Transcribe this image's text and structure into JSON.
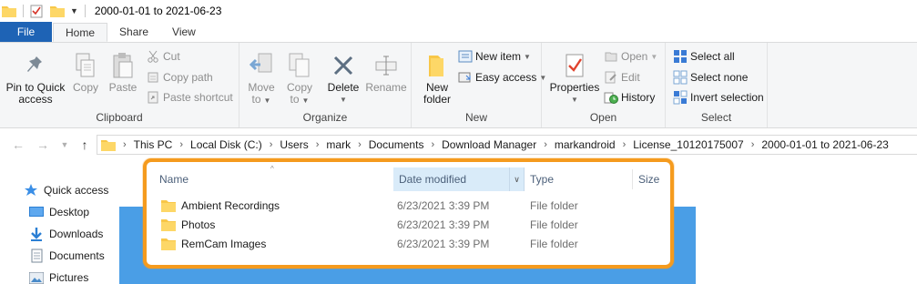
{
  "window": {
    "title": "2000-01-01 to 2021-06-23"
  },
  "tabs": [
    {
      "label": "File"
    },
    {
      "label": "Home"
    },
    {
      "label": "Share"
    },
    {
      "label": "View"
    }
  ],
  "ribbon": {
    "clipboard": {
      "label": "Clipboard",
      "pin_line1": "Pin to Quick",
      "pin_line2": "access",
      "copy": "Copy",
      "paste": "Paste",
      "cut": "Cut",
      "copy_path": "Copy path",
      "paste_shortcut": "Paste shortcut"
    },
    "organize": {
      "label": "Organize",
      "move_line1": "Move",
      "move_line2": "to",
      "copy_line1": "Copy",
      "copy_line2": "to",
      "delete": "Delete",
      "rename": "Rename"
    },
    "new": {
      "label": "New",
      "new_folder_line1": "New",
      "new_folder_line2": "folder",
      "new_item": "New item",
      "easy_access": "Easy access"
    },
    "open": {
      "label": "Open",
      "properties": "Properties",
      "open": "Open",
      "edit": "Edit",
      "history": "History"
    },
    "select": {
      "label": "Select",
      "select_all": "Select all",
      "select_none": "Select none",
      "invert_selection": "Invert selection"
    }
  },
  "breadcrumb": [
    "This PC",
    "Local Disk (C:)",
    "Users",
    "mark",
    "Documents",
    "Download Manager",
    "markandroid",
    "License_10120175007",
    "2000-01-01 to 2021-06-23"
  ],
  "nav_pane": [
    {
      "label": "Quick access",
      "icon": "star-icon"
    },
    {
      "label": "Desktop",
      "icon": "desktop-icon"
    },
    {
      "label": "Downloads",
      "icon": "download-icon"
    },
    {
      "label": "Documents",
      "icon": "documents-icon"
    },
    {
      "label": "Pictures",
      "icon": "pictures-icon"
    }
  ],
  "columns": {
    "name": "Name",
    "date_modified": "Date modified",
    "type": "Type",
    "size": "Size"
  },
  "files": [
    {
      "name": "Ambient Recordings",
      "date": "6/23/2021 3:39 PM",
      "type": "File folder"
    },
    {
      "name": "Photos",
      "date": "6/23/2021 3:39 PM",
      "type": "File folder"
    },
    {
      "name": "RemCam Images",
      "date": "6/23/2021 3:39 PM",
      "type": "File folder"
    }
  ],
  "colors": {
    "file_tab": "#1e63b5",
    "highlight_outline": "#f59b1e",
    "folder": "#f8c748",
    "sorted_header": "#d9ebf9"
  }
}
